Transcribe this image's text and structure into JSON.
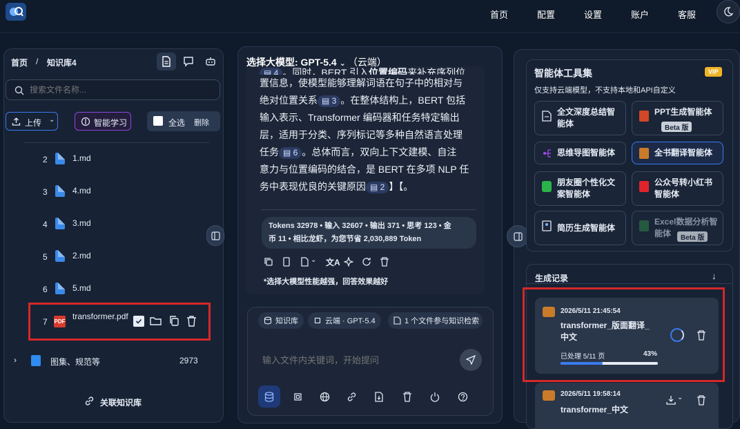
{
  "nav": {
    "home": "首页",
    "config": "配置",
    "settings": "设置",
    "account": "账户",
    "support": "客服"
  },
  "left": {
    "breadcrumb_root": "首页",
    "breadcrumb_sep": "/",
    "breadcrumb_current": "知识库4",
    "search_placeholder": "搜索文件名称...",
    "upload": "上传",
    "smart_learn": "智能学习",
    "select_all": "全选",
    "delete": "删除",
    "files": [
      {
        "index": "2",
        "name": "1.md"
      },
      {
        "index": "3",
        "name": "4.md"
      },
      {
        "index": "4",
        "name": "3.md"
      },
      {
        "index": "5",
        "name": "2.md"
      },
      {
        "index": "6",
        "name": "5.md"
      },
      {
        "index": "7",
        "name": "transformer.pdf"
      }
    ],
    "folder_name": "图集、规范等",
    "folder_count": "2973",
    "link_kb": "关联知识库"
  },
  "middle": {
    "model_label": "选择大模型: GPT-5.4",
    "model_mode": "（云端）",
    "para_partial": "。同时，BERT 引入",
    "para_bold": "位置编码",
    "para_partial2": "来补充序列位",
    "chip4": "4",
    "para_l2": "置信息，使模型能够理解词语在句子中的相对与",
    "para_l3": "绝对位置关系",
    "chip3": "3",
    "para_l3b": "。在整体结构上，BERT 包括",
    "para_l4": "输入表示、Transformer 编码器和任务特定输出",
    "para_l5": "层，适用于分类、序列标记等多种自然语言处理",
    "para_l6a": "任务",
    "chip6": "6",
    "para_l6b": "。总体而言，双向上下文建模、自注",
    "para_l7": "意力与位置编码的结合，是 BERT 在多项 NLP 任",
    "para_l8a": "务中表现优良的关键原因",
    "chip2": "2",
    "para_l8b": "】【。",
    "tokens_line1": "Tokens 32978 • 输入 32607 • 输出 371 • 思考 123 • 金",
    "tokens_line2": "币 11 • 相比龙虾，为您节省 2,030,889 Token",
    "hint": "*选择大模型性能越强，回答效果越好",
    "chip_kb": "知识库",
    "chip_cloud": "云端 · GPT-5.4",
    "chip_files": "1 个文件参与知识检索",
    "input_placeholder": "输入文件内关键词，开始提问"
  },
  "right": {
    "title": "智能体工具集",
    "vip": "VIP",
    "subtitle": "仅支持云端模型，不支持本地和API自定义",
    "tools": [
      {
        "name": "全文深度总结智能体",
        "beta": ""
      },
      {
        "name": "PPT生成智能体",
        "beta": "Beta 版"
      },
      {
        "name": "思维导图智能体",
        "beta": ""
      },
      {
        "name": "全书翻译智能体",
        "beta": ""
      },
      {
        "name": "朋友圈个性化文案智能体",
        "beta": ""
      },
      {
        "name": "公众号转小红书智能体",
        "beta": ""
      },
      {
        "name": "简历生成智能体",
        "beta": ""
      },
      {
        "name": "Excel数据分析智能体",
        "beta": "Beta 版"
      }
    ],
    "records_title": "生成记录",
    "rec1_time": "2026/5/11 21:45:54",
    "rec1_name": "transformer_版面翻译_中文",
    "rec1_progress_text": "已处理 5/11 页",
    "rec1_percent": "43%",
    "rec1_progress": 0.43,
    "rec2_time": "2026/5/11 19:58:14",
    "rec2_name": "transformer_中文"
  },
  "colors": {
    "accent": "#3a7bef",
    "danger": "#d62828",
    "vip": "#f0b429"
  }
}
